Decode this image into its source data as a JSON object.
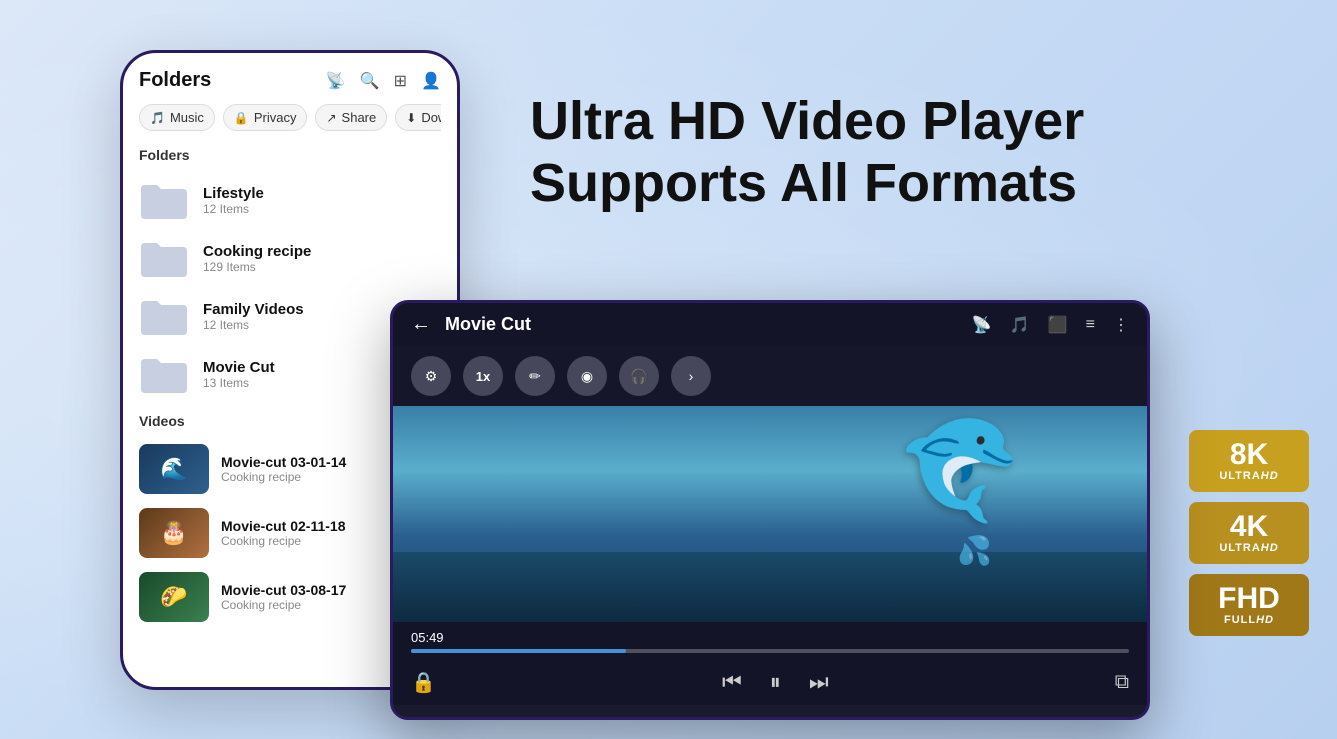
{
  "page": {
    "background": "#c8dcf5"
  },
  "headline": {
    "line1": "Ultra HD Video Player",
    "line2": "Supports All Formats"
  },
  "badges": [
    {
      "id": "8k",
      "num": "8K",
      "label": "ULTRA",
      "labelBold": "HD",
      "cls": "b8k"
    },
    {
      "id": "4k",
      "num": "4K",
      "label": "ULTRA",
      "labelBold": "HD",
      "cls": "b4k"
    },
    {
      "id": "fhd",
      "num": "FHD",
      "label": "FULL",
      "labelBold": "HD",
      "cls": "bfhd"
    }
  ],
  "phone": {
    "header_title": "Folders",
    "tabs": [
      {
        "label": "Music",
        "icon": "🎵"
      },
      {
        "label": "Privacy",
        "icon": "🔒"
      },
      {
        "label": "Share",
        "icon": "↗"
      },
      {
        "label": "Download",
        "icon": "⬇"
      }
    ],
    "folders_label": "Folders",
    "folders": [
      {
        "name": "Lifestyle",
        "sub": "12 Items"
      },
      {
        "name": "Cooking recipe",
        "sub": "129 Items"
      },
      {
        "name": "Family Videos",
        "sub": "12 Items"
      },
      {
        "name": "Movie Cut",
        "sub": "13 Items"
      }
    ],
    "videos_label": "Videos",
    "videos": [
      {
        "name": "Movie-cut 03-01-14",
        "sub": "Cooking recipe",
        "thumb": "thumb1",
        "emoji": "🌊"
      },
      {
        "name": "Movie-cut 02-11-18",
        "sub": "Cooking recipe",
        "thumb": "thumb2",
        "emoji": "🎂"
      },
      {
        "name": "Movie-cut 03-08-17",
        "sub": "Cooking recipe",
        "thumb": "thumb3",
        "emoji": "🌮"
      }
    ]
  },
  "tablet": {
    "title": "Movie Cut",
    "time": "05:49",
    "controls_top": [
      {
        "label": "⚙",
        "title": "equalizer"
      },
      {
        "label": "1x",
        "title": "speed"
      },
      {
        "label": "✏",
        "title": "edit"
      },
      {
        "label": "◉",
        "title": "record"
      },
      {
        "label": "🎧",
        "title": "audio"
      },
      {
        "label": "›",
        "title": "more"
      }
    ],
    "header_icons": [
      "📡",
      "🎵",
      "⬛",
      "≡",
      "⋮"
    ]
  }
}
